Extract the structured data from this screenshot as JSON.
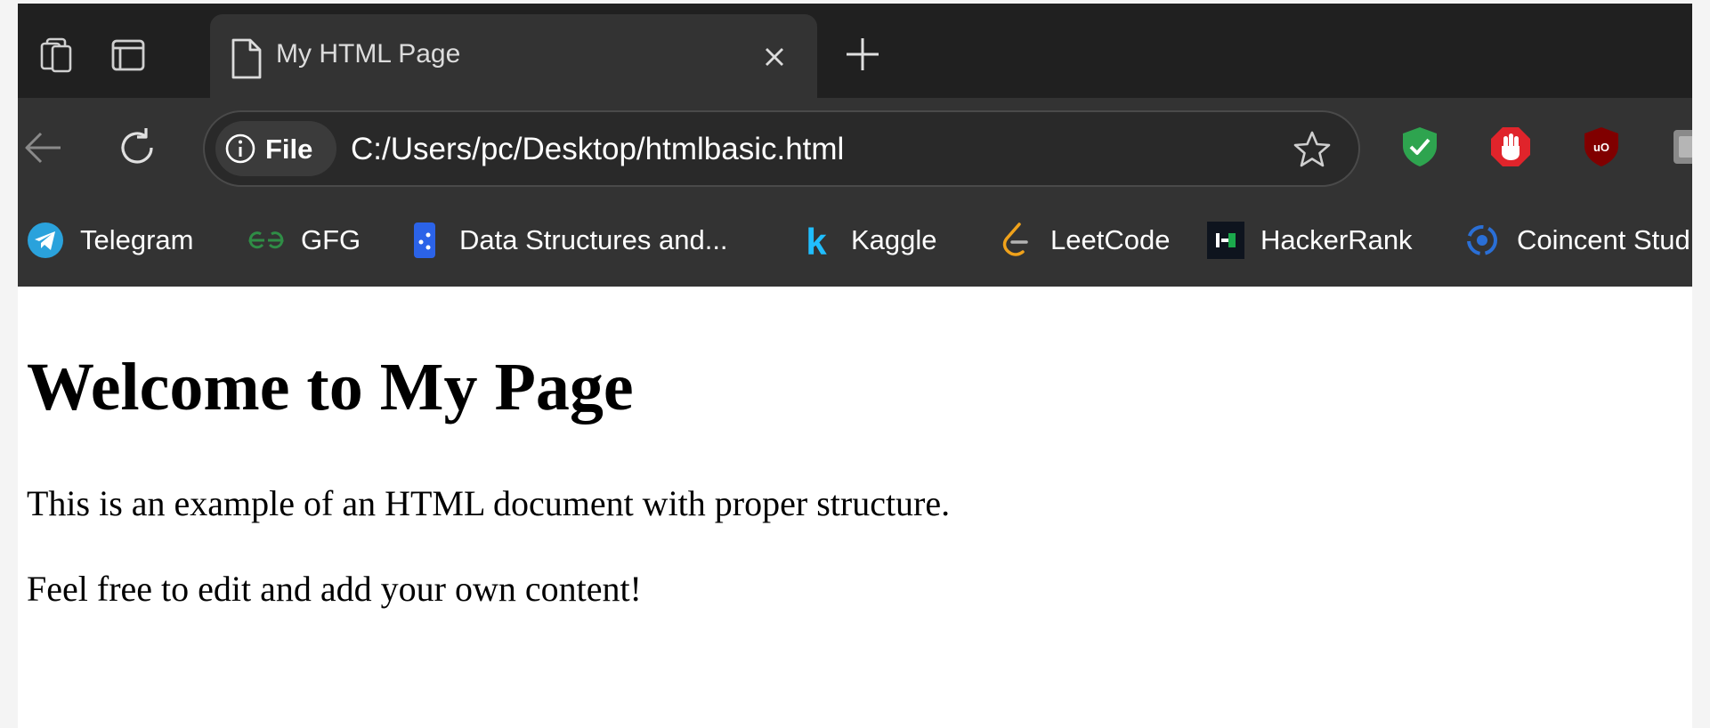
{
  "tab": {
    "title": "My HTML Page"
  },
  "toolbar": {
    "site_info_label": "File",
    "url": "C:/Users/pc/Desktop/htmlbasic.html"
  },
  "bookmarks": [
    {
      "label": "Telegram",
      "icon": "telegram-icon"
    },
    {
      "label": "GFG",
      "icon": "gfg-icon"
    },
    {
      "label": "Data Structures and...",
      "icon": "dsa-icon"
    },
    {
      "label": "Kaggle",
      "icon": "kaggle-icon"
    },
    {
      "label": "LeetCode",
      "icon": "leetcode-icon"
    },
    {
      "label": "HackerRank",
      "icon": "hackerrank-icon"
    },
    {
      "label": "Coincent Stud",
      "icon": "coincent-icon"
    }
  ],
  "extensions": [
    {
      "icon": "shield-check-icon",
      "color": "#2ea44f"
    },
    {
      "icon": "stop-hand-icon",
      "color": "#e0242b"
    },
    {
      "icon": "ublock-icon",
      "color": "#800000"
    },
    {
      "icon": "extension-icon",
      "color": "#8a8a8a"
    }
  ],
  "page": {
    "heading": "Welcome to My Page",
    "paragraphs": [
      "This is an example of an HTML document with proper structure.",
      "Feel free to edit and add your own content!"
    ]
  }
}
